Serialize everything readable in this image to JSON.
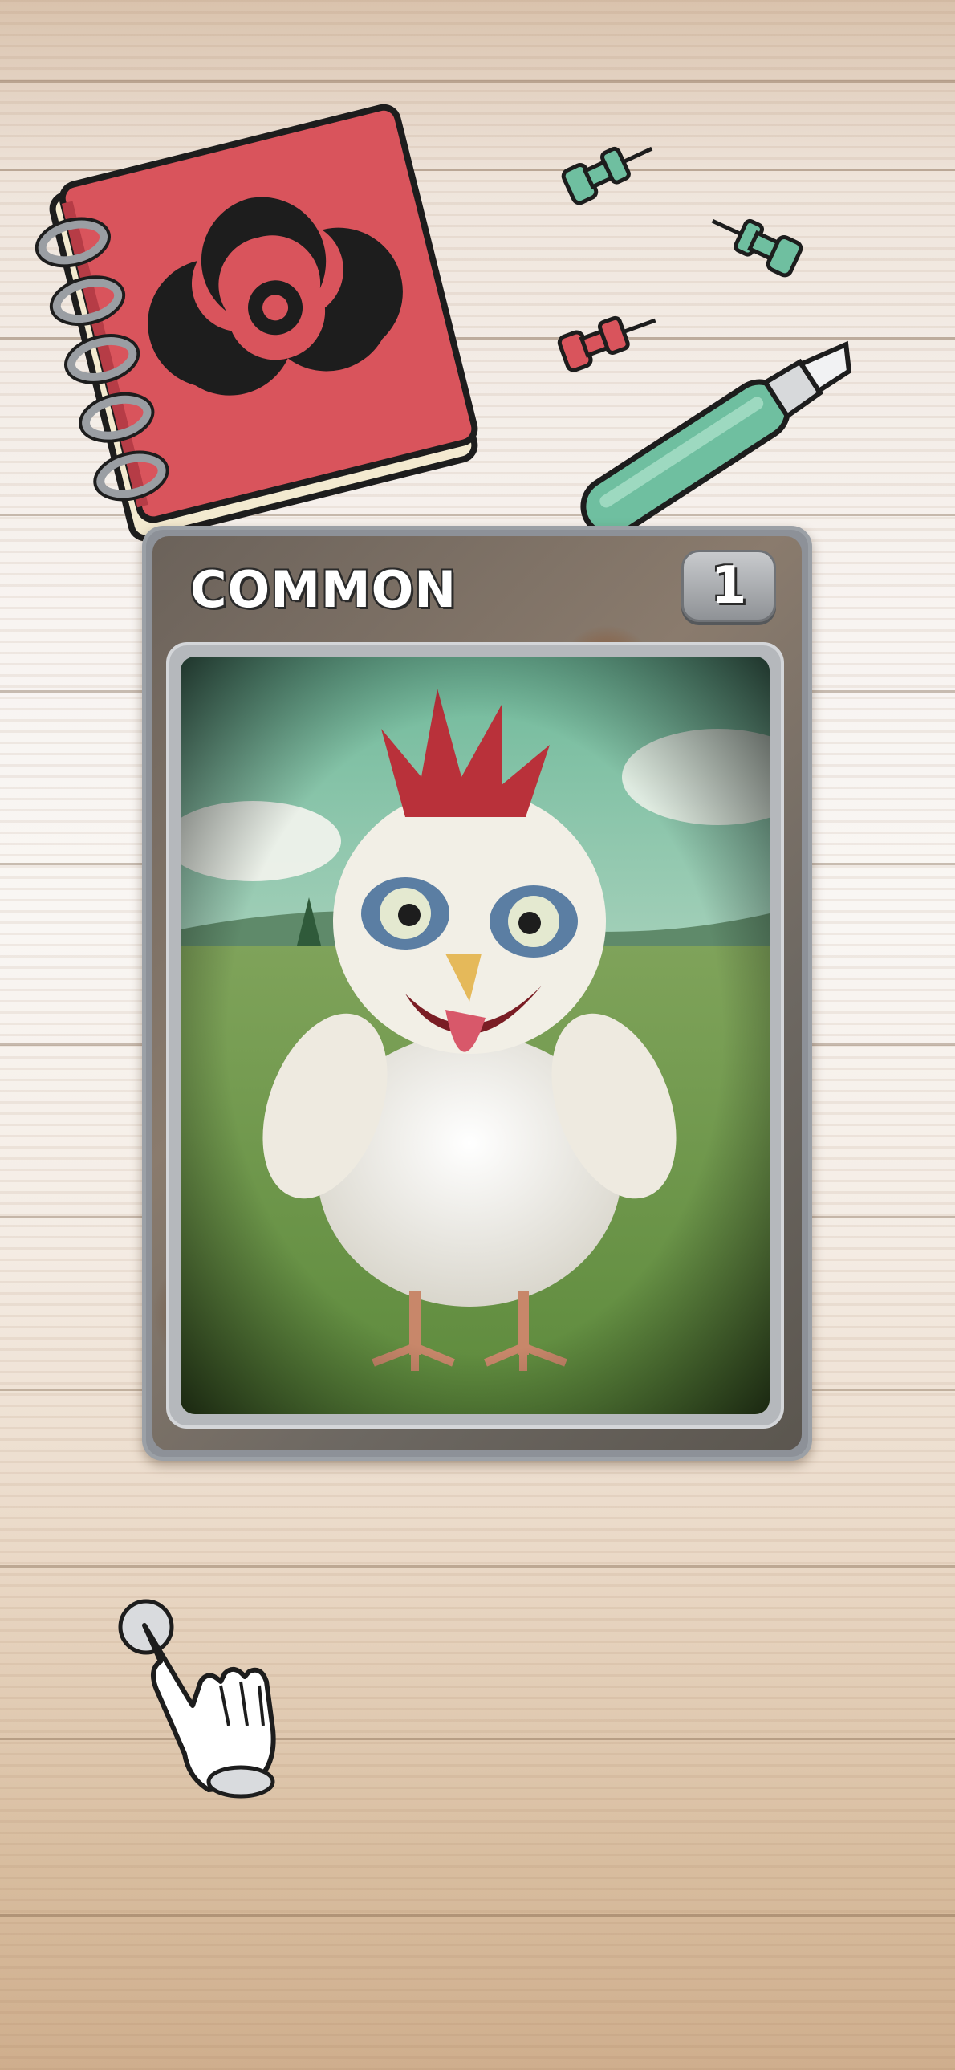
{
  "card": {
    "rarity_label": "COMMON",
    "level": "1",
    "creature": "chicken"
  },
  "colors": {
    "book_red": "#d9545c",
    "pin_green": "#6fbfa0",
    "pin_red": "#d9545c",
    "card_frame": "#8d9198"
  },
  "icons": {
    "book": "biohazard-book-icon",
    "tap_hint": "pointing-hand-icon"
  }
}
